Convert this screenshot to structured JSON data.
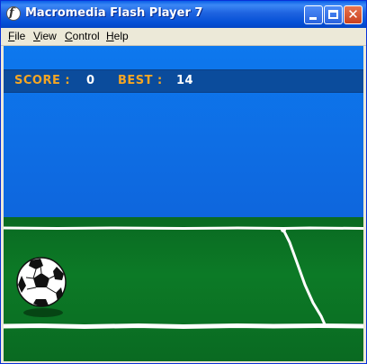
{
  "window": {
    "title": "Macromedia Flash Player 7",
    "app_icon_glyph": "f"
  },
  "window_controls": {
    "close_glyph": "✕"
  },
  "menu": {
    "items": [
      "File",
      "View",
      "Control",
      "Help"
    ]
  },
  "game": {
    "score_label": "SCORE :",
    "score_value": "0",
    "best_label": "BEST :",
    "best_value": "14"
  },
  "colors": {
    "sky": "#0d78ee",
    "score_bar": "#0b4c9c",
    "hud_label": "#f5a623",
    "grass": "#0c7a26",
    "field_lines": "#ffffff"
  },
  "icons": [
    "flash-player-icon",
    "minimize-icon",
    "maximize-icon",
    "close-icon",
    "soccer-ball-icon"
  ]
}
